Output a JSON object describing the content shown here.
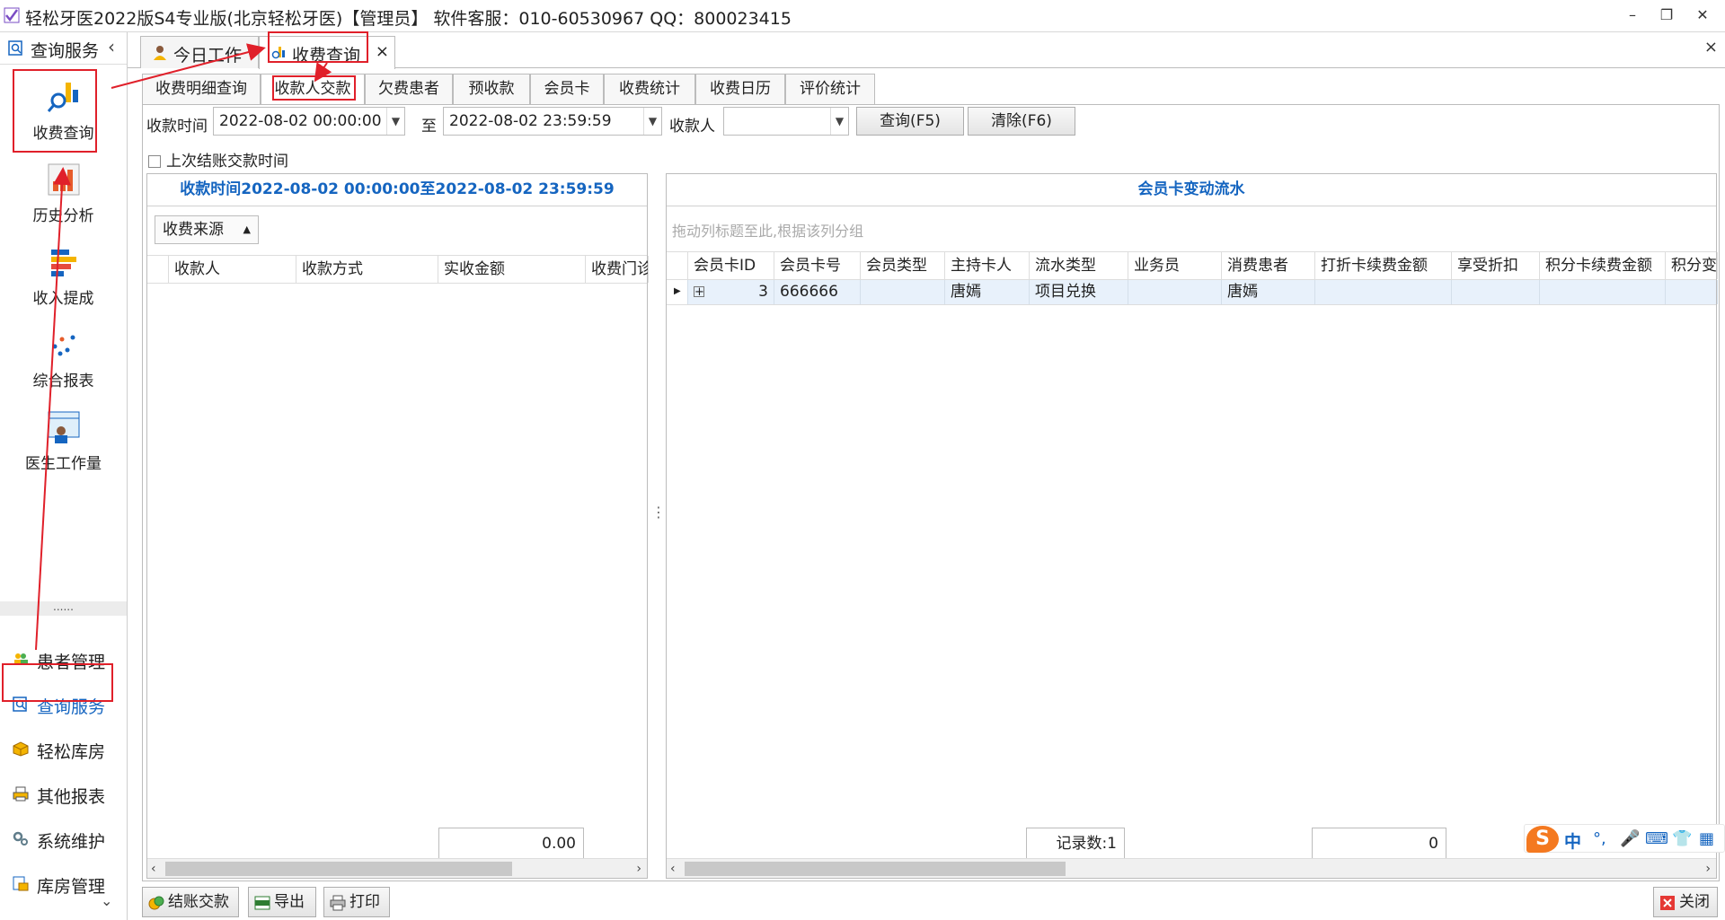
{
  "window": {
    "title": "轻松牙医2022版S4专业版(北京轻松牙医)【管理员】    软件客服：010-60530967 QQ：800023415"
  },
  "sidebar": {
    "header": "查询服务",
    "query_items": [
      {
        "label": "收费查询"
      },
      {
        "label": "历史分析"
      },
      {
        "label": "收入提成"
      },
      {
        "label": "综合报表"
      },
      {
        "label": "医生工作量"
      }
    ],
    "dots": "......",
    "nav_items": [
      {
        "label": "患者管理"
      },
      {
        "label": "查询服务"
      },
      {
        "label": "轻松库房"
      },
      {
        "label": "其他报表"
      },
      {
        "label": "系统维护"
      },
      {
        "label": "库房管理"
      }
    ]
  },
  "tabs": [
    {
      "label": "今日工作"
    },
    {
      "label": "收费查询"
    }
  ],
  "subtabs": [
    "收费明细查询",
    "收款人交款",
    "欠费患者",
    "预收款",
    "会员卡",
    "收费统计",
    "收费日历",
    "评价统计"
  ],
  "filter": {
    "time_label": "收款时间",
    "from": "2022-08-02 00:00:00",
    "to_label": "至",
    "to": "2022-08-02 23:59:59",
    "payee_label": "收款人",
    "payee_value": "",
    "query_button": "查询(F5)",
    "clear_button": "清除(F6)",
    "last_checkout_label": "上次结账交款时间"
  },
  "left_panel": {
    "title": "收款时间2022-08-02 00:00:00至2022-08-02 23:59:59",
    "group_button": "收费来源",
    "columns": [
      "收款人",
      "收款方式",
      "实收金额",
      "收费门诊"
    ],
    "total": "0.00"
  },
  "right_panel": {
    "title": "会员卡变动流水",
    "group_hint": "拖动列标题至此,根据该列分组",
    "columns": [
      "会员卡ID",
      "会员卡号",
      "会员类型",
      "主持卡人",
      "流水类型",
      "业务员",
      "消费患者",
      "打折卡续费金额",
      "享受折扣",
      "积分卡续费金额",
      "积分变化"
    ],
    "rows": [
      {
        "id": "3",
        "card_no": "666666",
        "type": "",
        "holder": "唐嫣",
        "flow_type": "项目兑换",
        "salesman": "",
        "patient": "唐嫣",
        "discount_renew": "",
        "discount": "",
        "points_renew": "",
        "points_change": ""
      }
    ],
    "record_count": "记录数:1",
    "sum": "0"
  },
  "bottom_bar": {
    "checkout_button": "结账交款",
    "export_button": "导出",
    "print_button": "打印",
    "close_button": "关闭"
  },
  "ime": {
    "lang": "中"
  },
  "colors": {
    "accent_blue": "#1565c0",
    "annotation_red": "#e0202a"
  }
}
